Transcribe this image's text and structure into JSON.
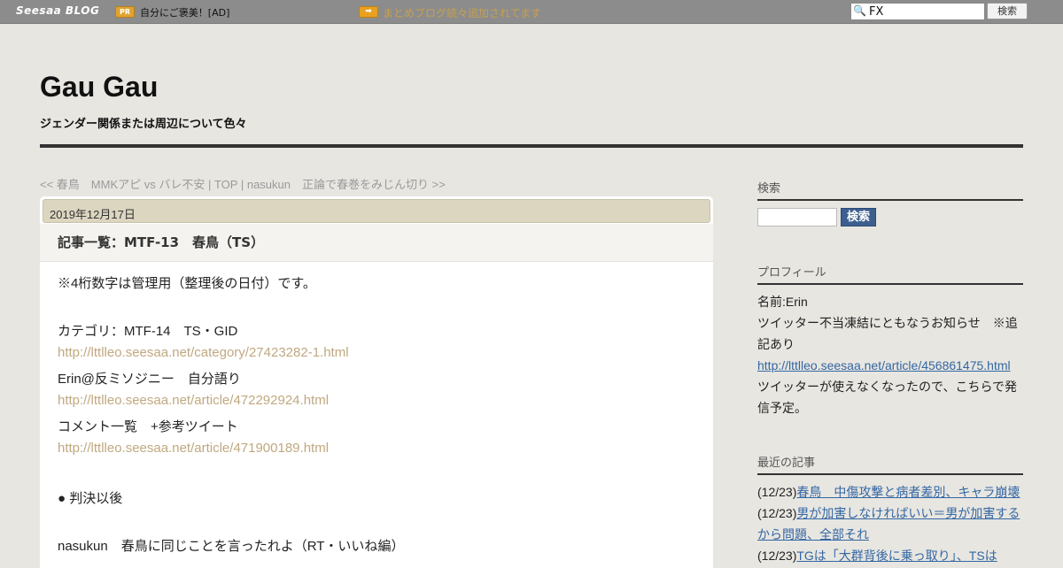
{
  "topbar": {
    "logo": "Seesaa BLOG",
    "pr_badge": "PR",
    "pr_text": "自分にご褒美！[AD]",
    "arrow_badge": "➡",
    "promo": "まとめブログ続々追加されてます",
    "search_value": "FX",
    "search_button": "検索"
  },
  "header": {
    "title": "Gau Gau",
    "description": "ジェンダー関係または周辺について色々"
  },
  "nav": {
    "prev": "<< 春鳥　MMKアピ vs バレ不安",
    "sep1": " | ",
    "top": "TOP",
    "sep2": " | ",
    "next": "nasukun　正論で春巻をみじん切り >>"
  },
  "article": {
    "date": "2019年12月17日",
    "title": "記事一覧：MTF-13　春鳥（TS）",
    "lines": [
      {
        "text": "※4桁数字は管理用（整理後の日付）です。",
        "link": false
      },
      {
        "text": "カテゴリ：MTF-14　TS・GID",
        "link": false
      },
      {
        "text": "http://lttlleo.seesaa.net/category/27423282-1.html",
        "link": true
      },
      {
        "text": "Erin@反ミソジニー　自分語り",
        "link": false
      },
      {
        "text": "http://lttlleo.seesaa.net/article/472292924.html",
        "link": true
      },
      {
        "text": "コメント一覧　+参考ツイート",
        "link": false
      },
      {
        "text": "http://lttlleo.seesaa.net/article/471900189.html",
        "link": true
      },
      {
        "text": "● 判決以後",
        "link": false
      },
      {
        "text": "nasukun　春鳥に同じことを言ったれよ（RT・いいね編）",
        "link": false
      }
    ]
  },
  "sidebar": {
    "search_heading": "検索",
    "search_button": "検索",
    "profile_heading": "プロフィール",
    "profile_name": "名前:Erin",
    "profile_notice": "ツイッター不当凍結にともなうお知らせ　※追記あり",
    "profile_link": "http://lttlleo.seesaa.net/article/456861475.html",
    "profile_note": "ツイッターが使えなくなったので、こちらで発信予定。",
    "recent_heading": "最近の記事",
    "recent": [
      {
        "date": "(12/23)",
        "title": "春鳥　中傷攻撃と病者差別、キャラ崩壊"
      },
      {
        "date": "(12/23)",
        "title": "男が加害しなければいい＝男が加害するから問題、全部それ"
      },
      {
        "date": "(12/23)",
        "title": "TGは「大群背後に乗っ取り」、TSは"
      }
    ]
  },
  "colors": {
    "page_bg": "#e8e6e1",
    "topbar_bg": "#8c8c8c",
    "date_bar": "#dcd6c0",
    "article_link": "#c0a880",
    "side_link": "#3367a3",
    "side_button": "#3d5f8f"
  },
  "icons": {
    "search": "magnifier-icon",
    "arrow": "arrow-right-icon"
  }
}
